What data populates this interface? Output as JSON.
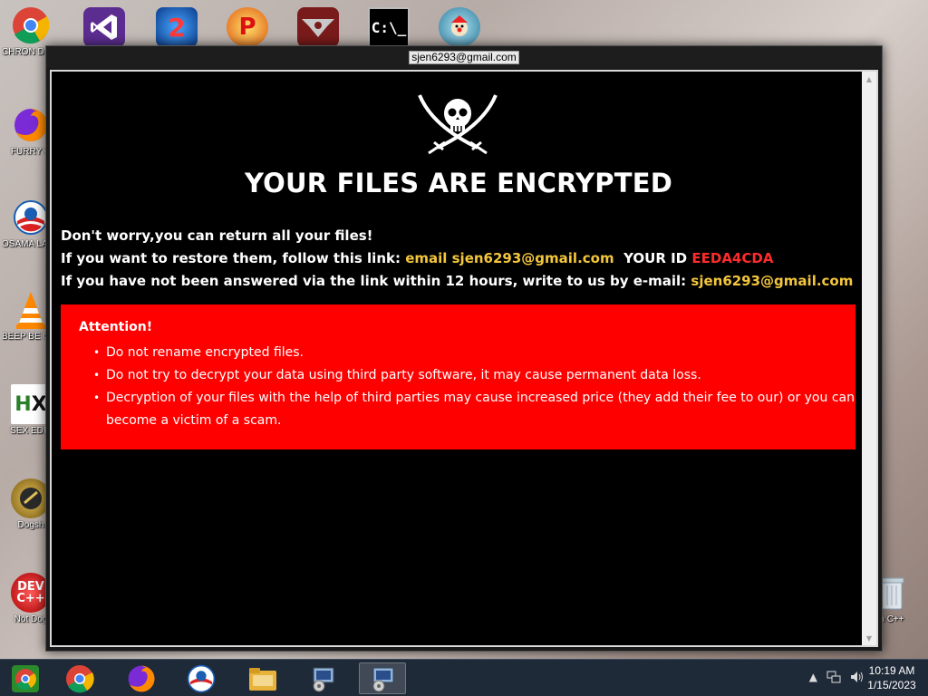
{
  "window": {
    "title": "sjen6293@gmail.com"
  },
  "note": {
    "headline": "YOUR FILES ARE ENCRYPTED",
    "line1": "Don't worry,you can return all your files!",
    "line2_prefix": "If you want to restore them, follow this link: ",
    "line2_link": "email sjen6293@gmail.com",
    "line2_id_label": "YOUR ID",
    "line2_id_value": "EEDA4CDA",
    "line3_prefix": "If you have not been answered via the link within 12 hours, write to us by e-mail: ",
    "line3_email": "sjen6293@gmail.com",
    "attention_title": "Attention!",
    "rules": [
      "Do not rename encrypted files.",
      "Do not try to decrypt your data using third party software, it may cause permanent data loss.",
      "Decryption of your files with the help of third parties may cause increased price (they add their fee to our) or you can become a victim of a scam."
    ]
  },
  "desktop_icons": [
    {
      "label": "CHRON DISEA",
      "icon": "chrome-icon"
    },
    {
      "label": "FURRY C",
      "icon": "firefox-icon"
    },
    {
      "label": "OSAMA LADEN",
      "icon": "obama-icon"
    },
    {
      "label": "BEEP BE CAR",
      "icon": "vlc-icon"
    },
    {
      "label": "SEX EDIT",
      "icon": "hex-editor-icon"
    },
    {
      "label": "Dogsh",
      "icon": "doge-icon"
    },
    {
      "label": "Not Dog",
      "icon": "devcpp-icon"
    },
    {
      "label": "n C++",
      "icon": "recycle-bin-icon"
    }
  ],
  "taskbar": {
    "time": "10:19 AM",
    "date": "1/15/2023"
  },
  "colors": {
    "accent_yellow": "#f3c63c",
    "id_red": "#ff2b2b",
    "attention_bg": "#ff0000",
    "taskbar_bg": "#1f2a38"
  }
}
